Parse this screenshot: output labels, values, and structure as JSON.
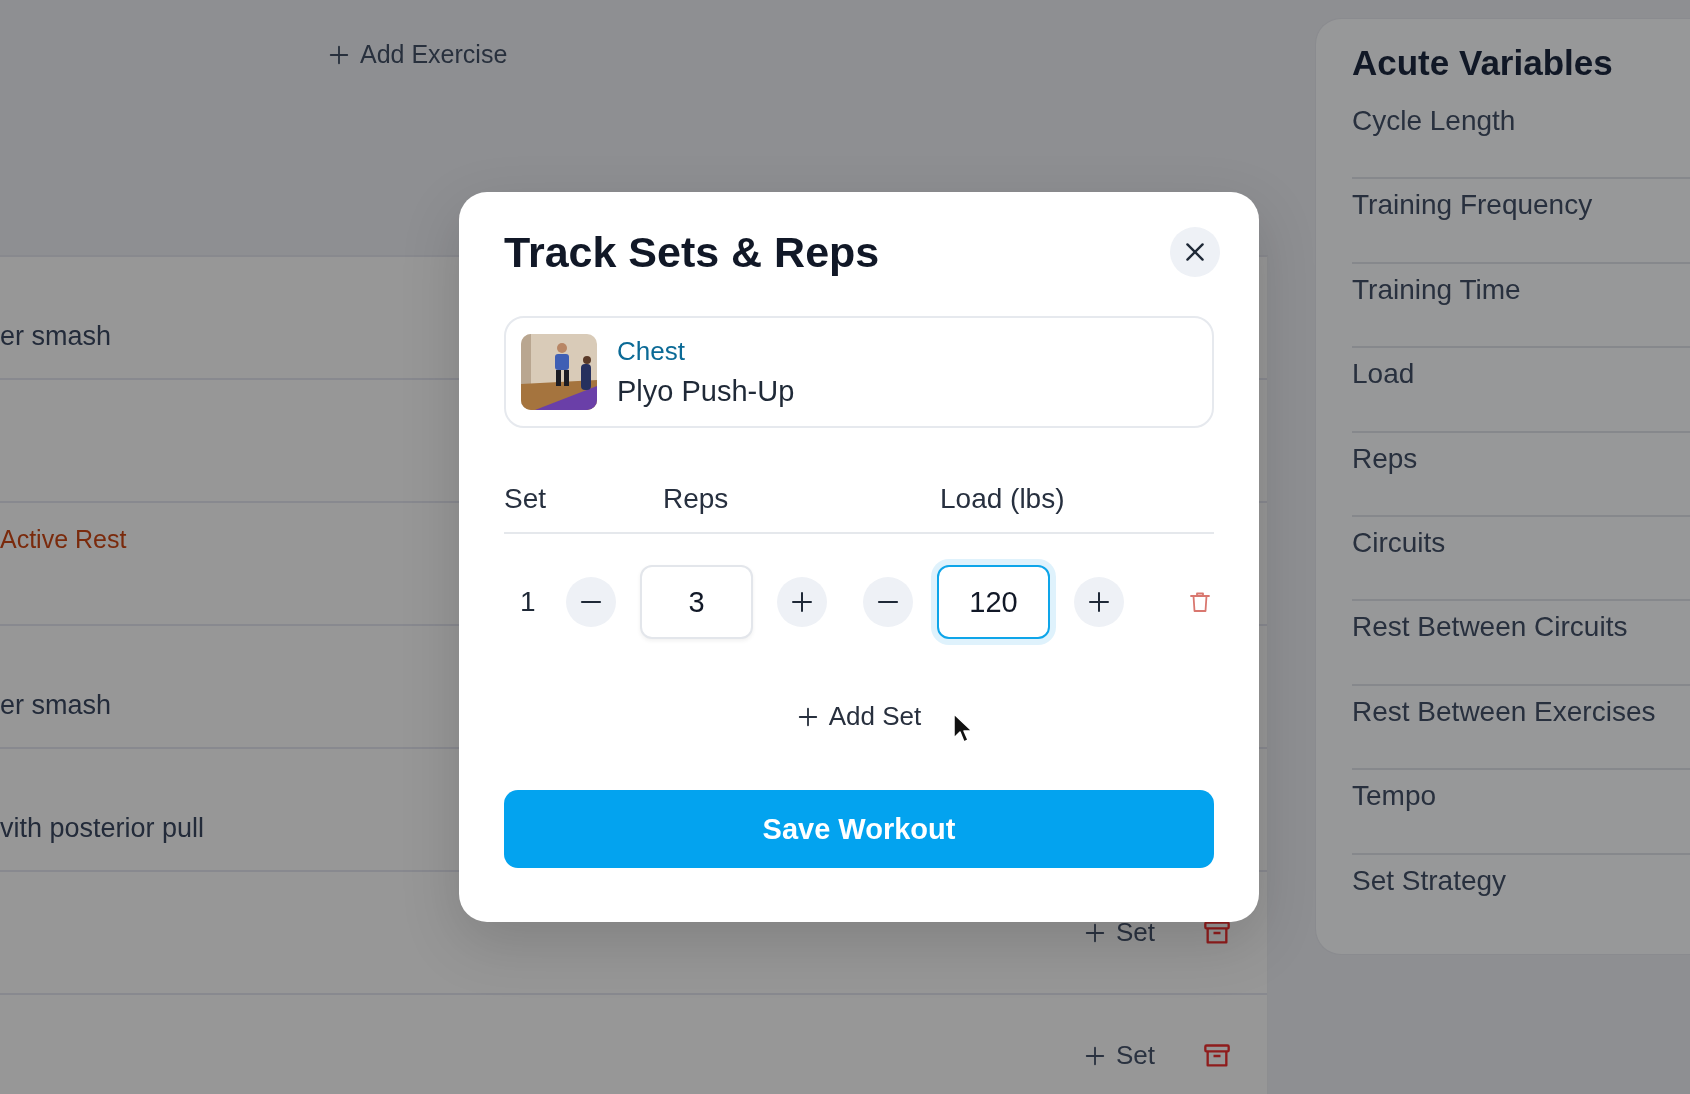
{
  "workout": {
    "add_exercise": "Add Exercise",
    "rows": [
      {
        "kind": "exercise",
        "text": "er smash"
      },
      {
        "kind": "blank"
      },
      {
        "kind": "rest",
        "text": "Active Rest"
      },
      {
        "kind": "exercise",
        "text": "er smash"
      },
      {
        "kind": "exercise",
        "text": "vith posterior pull"
      },
      {
        "kind": "actions",
        "add_set": "Set"
      },
      {
        "kind": "actions",
        "add_set": "Set"
      }
    ]
  },
  "acute_variables": {
    "title": "Acute Variables",
    "items": [
      "Cycle Length",
      "Training Frequency",
      "Training Time",
      "Load",
      "Reps",
      "Circuits",
      "Rest Between Circuits",
      "Rest Between Exercises",
      "Tempo",
      "Set Strategy"
    ]
  },
  "dialog": {
    "title": "Track Sets & Reps",
    "exercise": {
      "category": "Chest",
      "name": "Plyo Push-Up"
    },
    "columns": [
      "Set",
      "Reps",
      "Load (lbs)"
    ],
    "sets": [
      {
        "number": "1",
        "reps": "3",
        "load": "120",
        "load_focused": true
      }
    ],
    "add_set": "Add Set",
    "save": "Save Workout"
  }
}
